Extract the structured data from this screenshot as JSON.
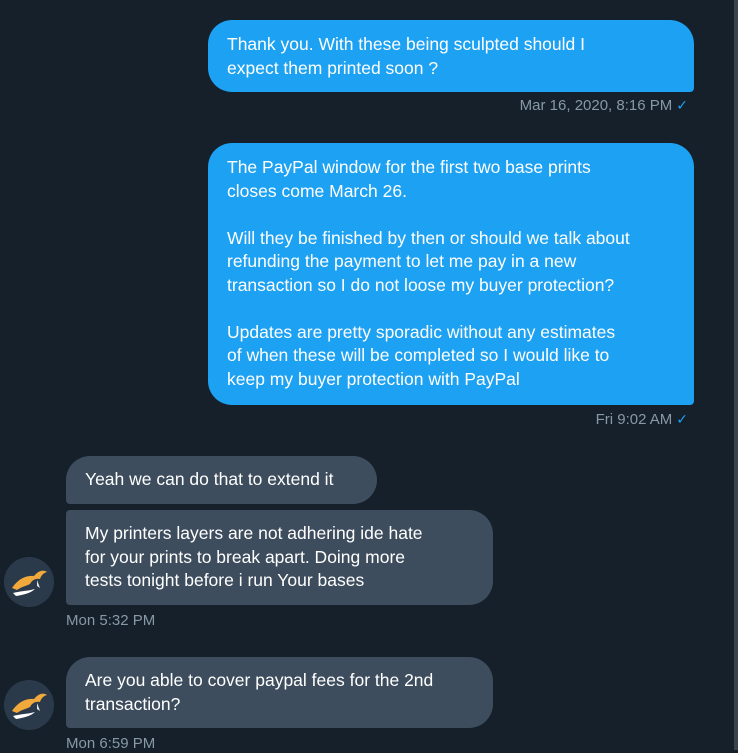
{
  "messages": [
    {
      "text": "Thank you. With these being sculpted should I\nexpect them printed soon ?",
      "timestamp": "Mar 16, 2020, 8:16 PM"
    },
    {
      "text": "The PayPal window for the first two base prints\ncloses come March 26.\n\nWill they be finished by then or should we talk about\nrefunding the payment to let me pay in a new\ntransaction so I do not loose my buyer protection?\n\nUpdates are pretty sporadic without any estimates\nof when these will be completed so I would like to\nkeep my buyer protection with PayPal",
      "timestamp": "Fri 9:02 AM"
    },
    {
      "text": "Yeah we can do that to extend it"
    },
    {
      "text": "My printers layers are not adhering ide hate\nfor your prints to break apart. Doing more\ntests tonight before i run Your bases",
      "timestamp": "Mon 5:32 PM"
    },
    {
      "text": "Are you able to cover paypal fees for the 2nd\ntransaction?",
      "timestamp": "Mon 6:59 PM"
    }
  ],
  "read_receipt_glyph": "✓",
  "colors": {
    "background": "#15202b",
    "outgoing_bubble": "#1da1f2",
    "incoming_bubble": "#3d4d5d",
    "timestamp_text": "#8899a6",
    "avatar_accent": "#f2a93b"
  },
  "icons": {
    "avatar": "kangaroo-logo-icon",
    "read_receipt": "checkmark-icon"
  }
}
